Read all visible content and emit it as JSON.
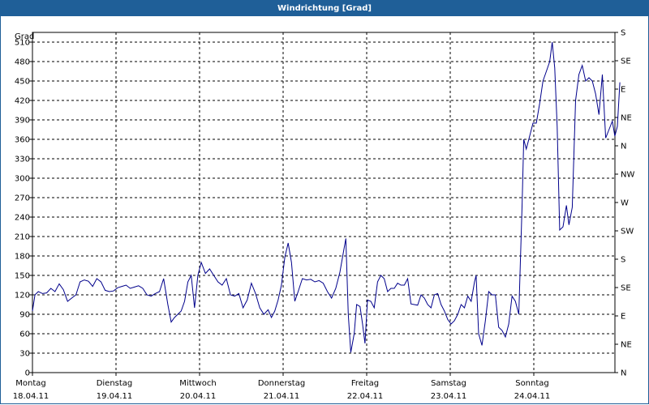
{
  "window": {
    "title": "Windrichtung [Grad]"
  },
  "chart_data": {
    "type": "line",
    "title": "Windrichtung [Grad]",
    "ylabel": "Grad",
    "ylim": [
      0,
      525
    ],
    "yticks": [
      0,
      30,
      60,
      90,
      120,
      150,
      180,
      210,
      240,
      270,
      300,
      330,
      360,
      390,
      420,
      450,
      480,
      510
    ],
    "right_ticks": [
      {
        "value": 0,
        "label": "N"
      },
      {
        "value": 45,
        "label": "NE"
      },
      {
        "value": 90,
        "label": "E"
      },
      {
        "value": 135,
        "label": "SE"
      },
      {
        "value": 180,
        "label": "S"
      },
      {
        "value": 225,
        "label": "SW"
      },
      {
        "value": 270,
        "label": "W"
      },
      {
        "value": 315,
        "label": "NW"
      },
      {
        "value": 360,
        "label": "N"
      },
      {
        "value": 405,
        "label": "NE"
      },
      {
        "value": 450,
        "label": "E"
      },
      {
        "value": 495,
        "label": "SE"
      },
      {
        "value": 540,
        "label": "S"
      }
    ],
    "xlim": [
      0,
      7
    ],
    "days": [
      {
        "day": "Montag",
        "date": "18.04.11"
      },
      {
        "day": "Dienstag",
        "date": "19.04.11"
      },
      {
        "day": "Mittwoch",
        "date": "20.04.11"
      },
      {
        "day": "Donnerstag",
        "date": "21.04.11"
      },
      {
        "day": "Freitag",
        "date": "22.04.11"
      },
      {
        "day": "Samstag",
        "date": "23.04.11"
      },
      {
        "day": "Sonntag",
        "date": "24.04.11"
      }
    ],
    "grid": true,
    "color": "#00008b",
    "series": [
      {
        "points": [
          [
            0.0,
            95
          ],
          [
            0.03,
            120
          ],
          [
            0.07,
            125
          ],
          [
            0.12,
            122
          ],
          [
            0.17,
            123
          ],
          [
            0.22,
            130
          ],
          [
            0.27,
            125
          ],
          [
            0.32,
            137
          ],
          [
            0.37,
            128
          ],
          [
            0.42,
            110
          ],
          [
            0.47,
            115
          ],
          [
            0.52,
            120
          ],
          [
            0.57,
            140
          ],
          [
            0.62,
            143
          ],
          [
            0.67,
            141
          ],
          [
            0.72,
            133
          ],
          [
            0.77,
            145
          ],
          [
            0.82,
            140
          ],
          [
            0.87,
            127
          ],
          [
            0.92,
            125
          ],
          [
            0.97,
            126
          ],
          [
            1.02,
            131
          ],
          [
            1.07,
            133
          ],
          [
            1.12,
            135
          ],
          [
            1.17,
            130
          ],
          [
            1.22,
            132
          ],
          [
            1.27,
            134
          ],
          [
            1.32,
            130
          ],
          [
            1.37,
            120
          ],
          [
            1.42,
            118
          ],
          [
            1.47,
            122
          ],
          [
            1.52,
            125
          ],
          [
            1.57,
            145
          ],
          [
            1.62,
            105
          ],
          [
            1.66,
            78
          ],
          [
            1.7,
            85
          ],
          [
            1.74,
            90
          ],
          [
            1.78,
            95
          ],
          [
            1.82,
            110
          ],
          [
            1.86,
            140
          ],
          [
            1.9,
            150
          ],
          [
            1.94,
            100
          ],
          [
            1.98,
            150
          ],
          [
            2.02,
            170
          ],
          [
            2.07,
            153
          ],
          [
            2.12,
            160
          ],
          [
            2.17,
            150
          ],
          [
            2.22,
            140
          ],
          [
            2.27,
            135
          ],
          [
            2.32,
            145
          ],
          [
            2.37,
            120
          ],
          [
            2.42,
            118
          ],
          [
            2.47,
            122
          ],
          [
            2.52,
            100
          ],
          [
            2.57,
            112
          ],
          [
            2.62,
            138
          ],
          [
            2.67,
            122
          ],
          [
            2.72,
            100
          ],
          [
            2.77,
            90
          ],
          [
            2.82,
            97
          ],
          [
            2.86,
            85
          ],
          [
            2.9,
            95
          ],
          [
            2.94,
            112
          ],
          [
            2.98,
            135
          ],
          [
            3.02,
            178
          ],
          [
            3.06,
            200
          ],
          [
            3.1,
            170
          ],
          [
            3.14,
            110
          ],
          [
            3.18,
            125
          ],
          [
            3.23,
            145
          ],
          [
            3.28,
            143
          ],
          [
            3.33,
            144
          ],
          [
            3.38,
            140
          ],
          [
            3.43,
            142
          ],
          [
            3.48,
            138
          ],
          [
            3.53,
            125
          ],
          [
            3.58,
            115
          ],
          [
            3.63,
            130
          ],
          [
            3.68,
            155
          ],
          [
            3.72,
            185
          ],
          [
            3.75,
            207
          ],
          [
            3.78,
            90
          ],
          [
            3.81,
            31
          ],
          [
            3.85,
            60
          ],
          [
            3.88,
            105
          ],
          [
            3.92,
            102
          ],
          [
            3.95,
            75
          ],
          [
            3.98,
            45
          ],
          [
            4.01,
            112
          ],
          [
            4.05,
            110
          ],
          [
            4.09,
            100
          ],
          [
            4.13,
            140
          ],
          [
            4.17,
            150
          ],
          [
            4.21,
            145
          ],
          [
            4.25,
            125
          ],
          [
            4.29,
            130
          ],
          [
            4.33,
            130
          ],
          [
            4.37,
            138
          ],
          [
            4.41,
            135
          ],
          [
            4.45,
            135
          ],
          [
            4.49,
            145
          ],
          [
            4.53,
            106
          ],
          [
            4.57,
            105
          ],
          [
            4.61,
            104
          ],
          [
            4.65,
            120
          ],
          [
            4.69,
            115
          ],
          [
            4.73,
            105
          ],
          [
            4.77,
            100
          ],
          [
            4.81,
            120
          ],
          [
            4.85,
            122
          ],
          [
            4.89,
            105
          ],
          [
            4.93,
            95
          ],
          [
            4.97,
            82
          ],
          [
            5.01,
            75
          ],
          [
            5.05,
            80
          ],
          [
            5.09,
            90
          ],
          [
            5.13,
            105
          ],
          [
            5.17,
            100
          ],
          [
            5.21,
            118
          ],
          [
            5.25,
            110
          ],
          [
            5.29,
            140
          ],
          [
            5.31,
            150
          ],
          [
            5.34,
            60
          ],
          [
            5.38,
            42
          ],
          [
            5.42,
            80
          ],
          [
            5.46,
            125
          ],
          [
            5.5,
            120
          ],
          [
            5.54,
            120
          ],
          [
            5.58,
            70
          ],
          [
            5.62,
            65
          ],
          [
            5.66,
            55
          ],
          [
            5.7,
            75
          ],
          [
            5.74,
            118
          ],
          [
            5.78,
            110
          ],
          [
            5.82,
            90
          ],
          [
            5.86,
            260
          ],
          [
            5.88,
            360
          ],
          [
            5.91,
            345
          ],
          [
            5.95,
            365
          ],
          [
            5.99,
            385
          ],
          [
            6.03,
            385
          ],
          [
            6.07,
            415
          ],
          [
            6.11,
            450
          ],
          [
            6.15,
            465
          ],
          [
            6.19,
            480
          ],
          [
            6.22,
            510
          ],
          [
            6.25,
            470
          ],
          [
            6.28,
            380
          ],
          [
            6.31,
            220
          ],
          [
            6.35,
            225
          ],
          [
            6.39,
            258
          ],
          [
            6.42,
            228
          ],
          [
            6.46,
            255
          ],
          [
            6.5,
            420
          ],
          [
            6.54,
            460
          ],
          [
            6.58,
            474
          ],
          [
            6.62,
            450
          ],
          [
            6.66,
            455
          ],
          [
            6.7,
            450
          ],
          [
            6.74,
            430
          ],
          [
            6.78,
            398
          ],
          [
            6.82,
            460
          ],
          [
            6.86,
            362
          ],
          [
            6.9,
            375
          ],
          [
            6.94,
            388
          ],
          [
            6.97,
            365
          ],
          [
            7.0,
            380
          ],
          [
            7.03,
            448
          ]
        ]
      }
    ]
  }
}
